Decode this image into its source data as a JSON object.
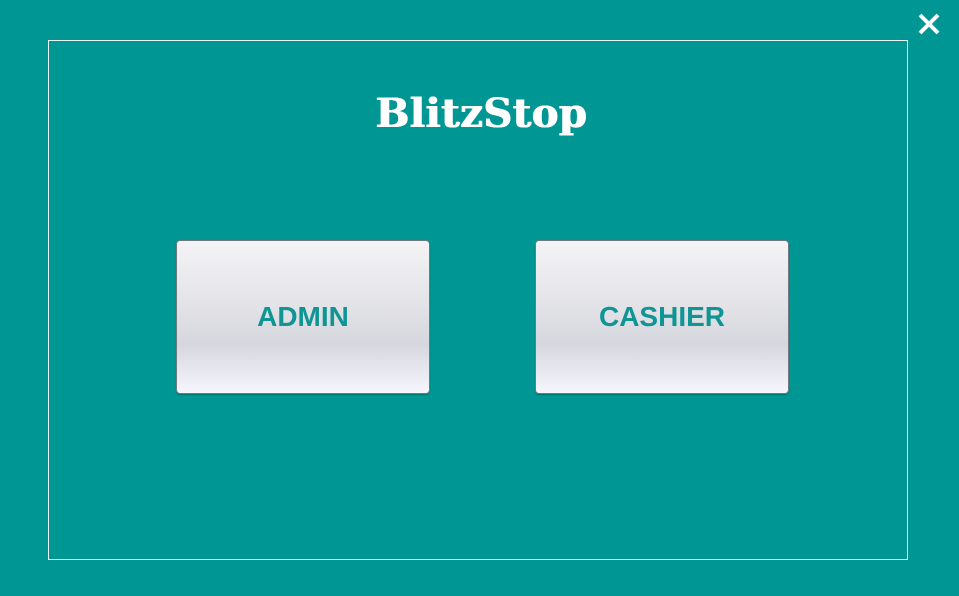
{
  "app": {
    "title": "BlitzStop"
  },
  "window": {
    "close_icon": "close-icon"
  },
  "roles": {
    "admin_label": "ADMIN",
    "cashier_label": "CASHIER"
  },
  "colors": {
    "background": "#009694",
    "accent_text": "#0f9593",
    "title_text": "#ffffff"
  }
}
